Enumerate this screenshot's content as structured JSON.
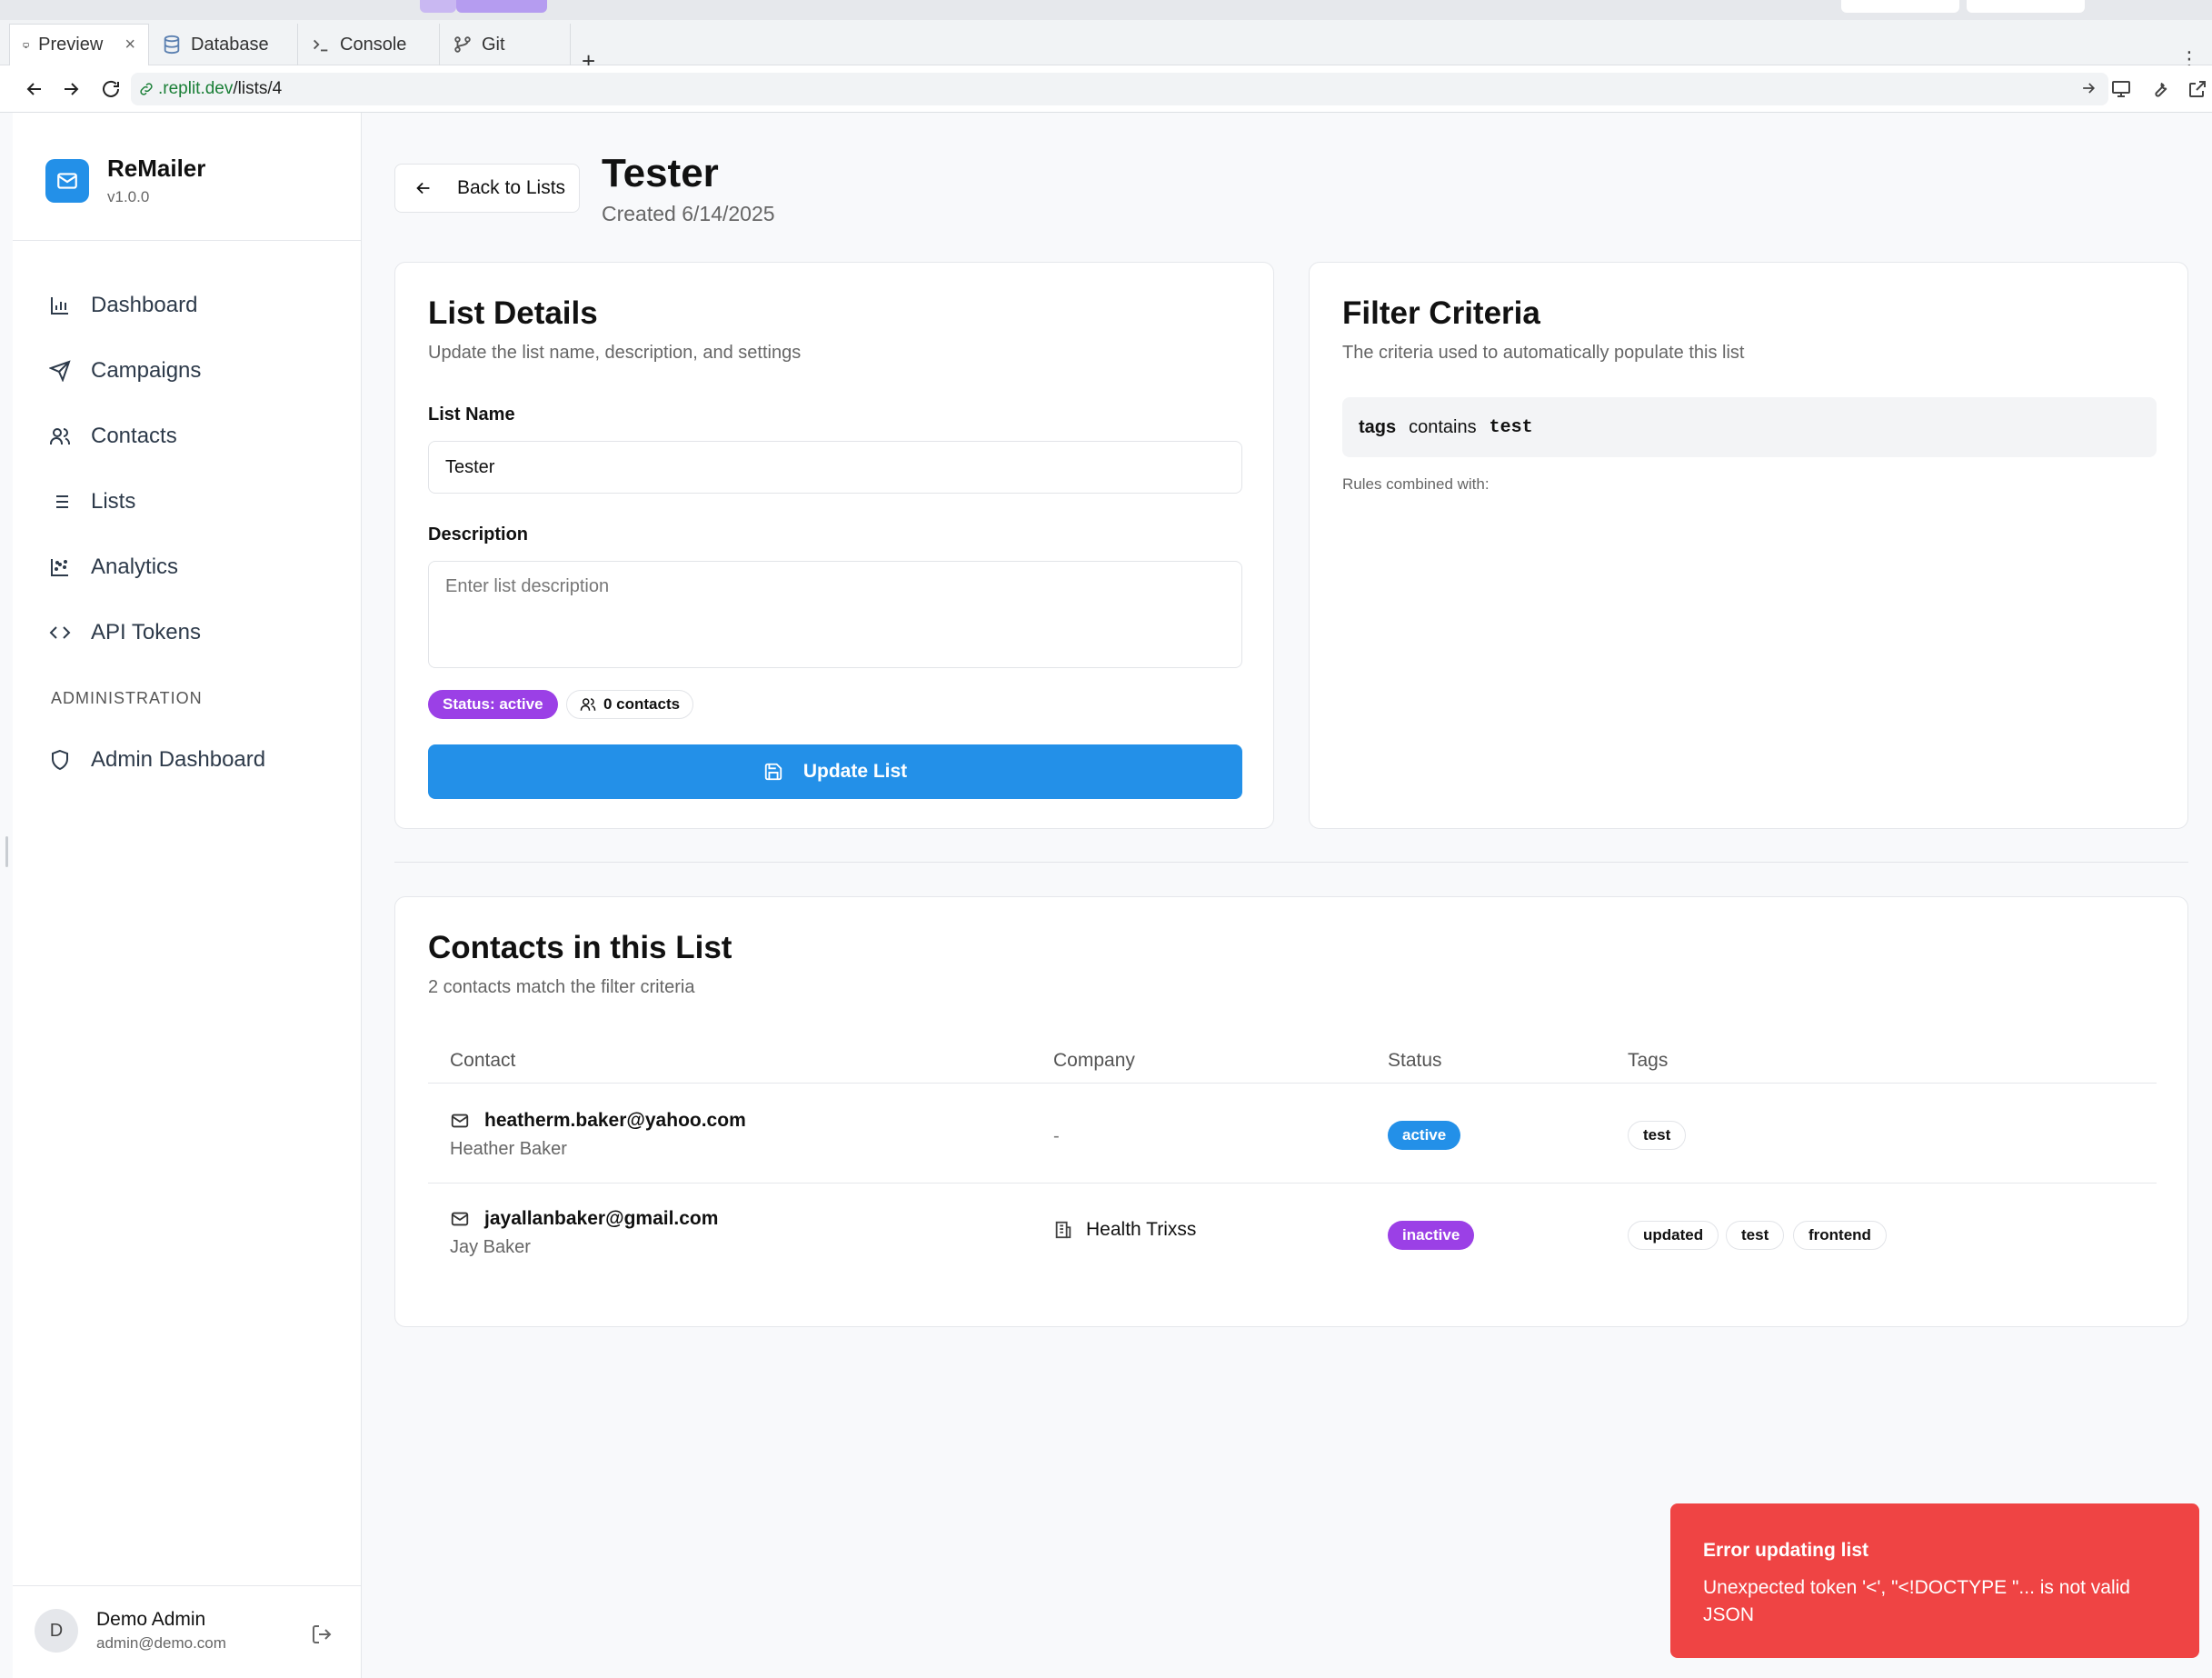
{
  "browser": {
    "tabs": [
      {
        "label": "Preview",
        "icon": "monitor-icon",
        "active": true,
        "close": "×"
      },
      {
        "label": "Database",
        "icon": "database-icon"
      },
      {
        "label": "Console",
        "icon": "terminal-icon"
      },
      {
        "label": "Git",
        "icon": "git-branch-icon"
      }
    ],
    "add_tab": "+",
    "kebab": "⋮",
    "url_domain": ".replit.dev",
    "url_path": "/lists/4"
  },
  "sidebar": {
    "brand_name": "ReMailer",
    "brand_version": "v1.0.0",
    "items": [
      {
        "label": "Dashboard",
        "icon": "bar-chart-icon"
      },
      {
        "label": "Campaigns",
        "icon": "send-icon"
      },
      {
        "label": "Contacts",
        "icon": "users-icon"
      },
      {
        "label": "Lists",
        "icon": "list-icon"
      },
      {
        "label": "Analytics",
        "icon": "scatter-chart-icon"
      },
      {
        "label": "API Tokens",
        "icon": "code-icon"
      }
    ],
    "section_admin": "ADMINISTRATION",
    "admin_item": {
      "label": "Admin Dashboard",
      "icon": "shield-icon"
    },
    "user": {
      "initial": "D",
      "name": "Demo Admin",
      "email": "admin@demo.com"
    }
  },
  "header": {
    "back_label": "Back to Lists",
    "title": "Tester",
    "created": "Created 6/14/2025"
  },
  "list_details": {
    "title": "List Details",
    "description": "Update the list name, description, and settings",
    "name_label": "List Name",
    "name_value": "Tester",
    "desc_label": "Description",
    "desc_placeholder": "Enter list description",
    "status_badge": "Status: active",
    "contacts_badge": "0 contacts",
    "update_button": "Update List"
  },
  "filter": {
    "title": "Filter Criteria",
    "description": "The criteria used to automatically populate this list",
    "field": "tags",
    "operator": "contains",
    "value": "test",
    "rules_combined": "Rules combined with:"
  },
  "contacts": {
    "title": "Contacts in this List",
    "description": "2 contacts match the filter criteria",
    "columns": [
      "Contact",
      "Company",
      "Status",
      "Tags"
    ],
    "rows": [
      {
        "email": "heatherm.baker@yahoo.com",
        "name": "Heather Baker",
        "company": "-",
        "status": "active",
        "tags": [
          "test"
        ]
      },
      {
        "email": "jayallanbaker@gmail.com",
        "name": "Jay Baker",
        "company": "Health Trixss",
        "status": "inactive",
        "tags": [
          "updated",
          "test",
          "frontend"
        ]
      }
    ]
  },
  "toast": {
    "title": "Error updating list",
    "message": "Unexpected token '<', \"<!DOCTYPE \"... is not valid JSON"
  },
  "colors": {
    "primary": "#2390e8",
    "purple_badge": "#9b40e6",
    "active_badge": "#2390e8",
    "error": "#ef4444"
  }
}
